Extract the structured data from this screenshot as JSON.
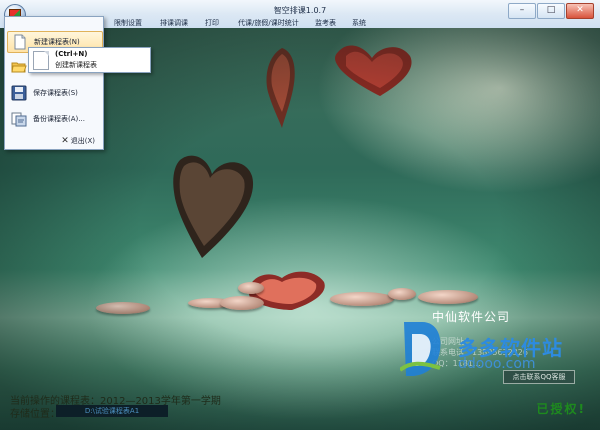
{
  "window": {
    "title": "智空排课1.0.7",
    "controls": {
      "minimize": "–",
      "maximize": "□",
      "close": "✕"
    }
  },
  "menubar": {
    "items": [
      "限制设置",
      "排课调课",
      "打印",
      "代课/旅假/课时统计",
      "监考表",
      "系统"
    ]
  },
  "app_menu": {
    "items": [
      {
        "label": "新建课程表(N)",
        "icon": "new-document-icon",
        "selected": true
      },
      {
        "label": "",
        "icon": "open-folder-icon",
        "selected": false
      },
      {
        "label": "保存课程表(S)",
        "icon": "save-disk-icon",
        "selected": false
      },
      {
        "label": "备份课程表(A)...",
        "icon": "backup-icon",
        "selected": false
      }
    ],
    "exit_label": "退出(X)"
  },
  "submenu": {
    "shortcut": "(Ctrl+N)",
    "description": "创建新课程表"
  },
  "company": {
    "name": "中仙软件公司",
    "lines": [
      "公司网址：",
      "联系电话：13895632326",
      "QQ：1181..."
    ],
    "qq_button": "点击联系QQ客服"
  },
  "watermark": {
    "site_name": "多多软件站",
    "site_url": "ddooo.com"
  },
  "status": {
    "current_label": "当前操作的课程表：2012—2013学年第一学期",
    "path_label": "存储位置：",
    "path_value": "D:\\试验课程表A1"
  },
  "license": {
    "text": "已授权!"
  },
  "colors": {
    "titlebar": "#dce8f4",
    "menu_highlight": "#ffe3a6",
    "authorized_green": "#1e8a1e",
    "watermark_blue": "#2d8be0"
  }
}
